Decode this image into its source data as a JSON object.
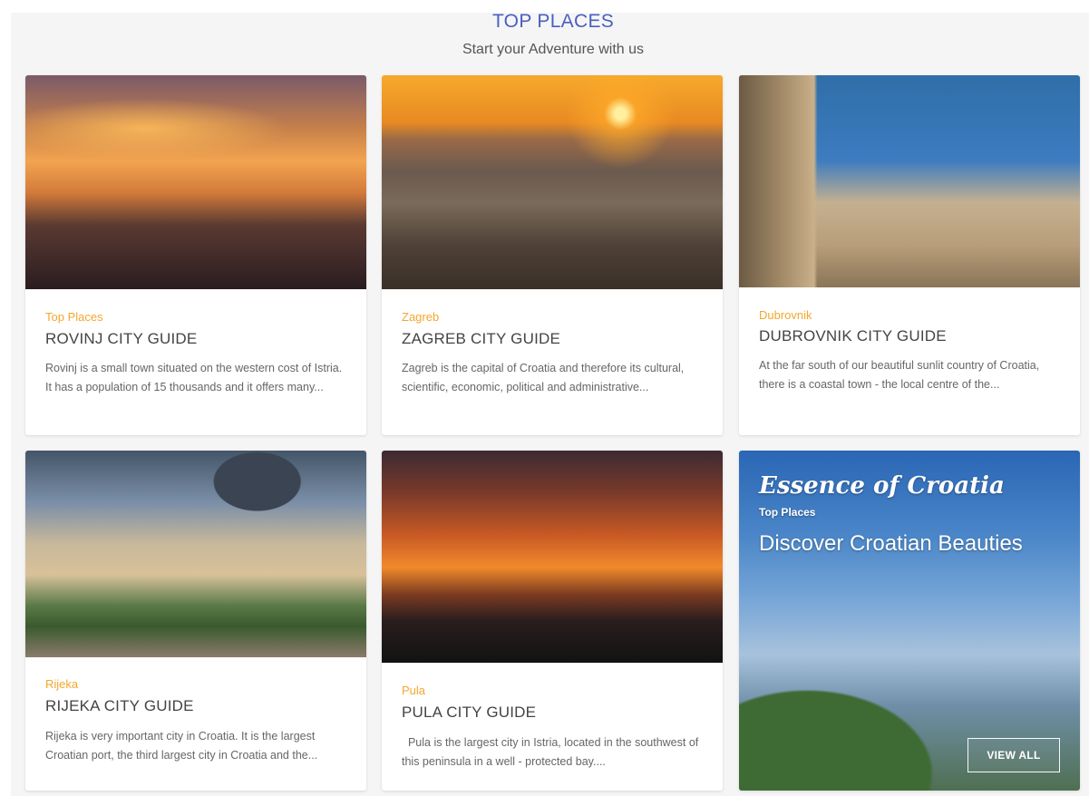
{
  "section": {
    "title": "TOP PLACES",
    "subtitle": "Start your Adventure with us"
  },
  "cards": [
    {
      "category": "Top Places",
      "title": "ROVINJ CITY GUIDE",
      "description": "Rovinj is a small town situated on the western cost of Istria. It has a population of 15 thousands and it offers many..."
    },
    {
      "category": "Zagreb",
      "title": "ZAGREB CITY GUIDE",
      "description": "Zagreb is the capital of Croatia and therefore its cultural, scientific, economic, political and administrative..."
    },
    {
      "category": "Dubrovnik",
      "title": "DUBROVNIK CITY GUIDE",
      "description": "At the far south of our beautiful sunlit country of Croatia, there is a coastal town - the local centre of the..."
    },
    {
      "category": "Rijeka",
      "title": "RIJEKA CITY GUIDE",
      "description": "Rijeka is very important city in Croatia. It is the largest Croatian port, the third largest city in Croatia and the..."
    },
    {
      "category": "Pula",
      "title": "PULA CITY GUIDE",
      "description": "  Pula is the largest city in Istria, located in the southwest of this peninsula in a well - protected bay...."
    }
  ],
  "promo": {
    "script_title": "Essence of Croatia",
    "category": "Top Places",
    "headline": "Discover Croatian Beauties",
    "button_label": "VIEW ALL"
  },
  "colors": {
    "heading": "#4a5fc1",
    "category": "#f4a72c"
  }
}
